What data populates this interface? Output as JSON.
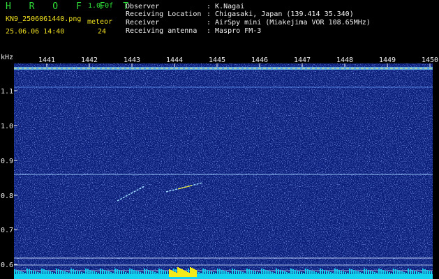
{
  "header": {
    "app_name": "H R O F F T",
    "version": "1.0.0f",
    "filename": "KN9_2506061440.png",
    "datetime": "25.06.06 14:40",
    "meteor_label": "meteor",
    "meteor_count": "24"
  },
  "info": [
    {
      "label": "Observer",
      "value": ": K.Nagai"
    },
    {
      "label": "Receiving Location",
      "value": ": Chigasaki, Japan (139.414 35.340)"
    },
    {
      "label": "Receiver",
      "value": ": AirSpy mini (Miakejima VOR 108.65MHz)"
    },
    {
      "label": "Receiving antenna",
      "value": ": Maspro FM-3"
    }
  ],
  "axis": {
    "y_unit": "kHz",
    "y_ticks": [
      "1.1",
      "1.0",
      "0.9",
      "0.8",
      "0.7",
      "0.6"
    ],
    "x_ticks": [
      "1441",
      "1442",
      "1443",
      "1444",
      "1445",
      "1446",
      "1447",
      "1448",
      "1449",
      "1450"
    ]
  },
  "colors": {
    "background": "#000000",
    "plot_background": "#0a1e7a",
    "green_text": "#2fe03a",
    "yellow_text": "#f0e020",
    "white_text": "#f2f2f2",
    "signal_line": "#9ad8ff",
    "power_bar": "#12d2f0",
    "power_peak": "#f4ea1a"
  }
}
